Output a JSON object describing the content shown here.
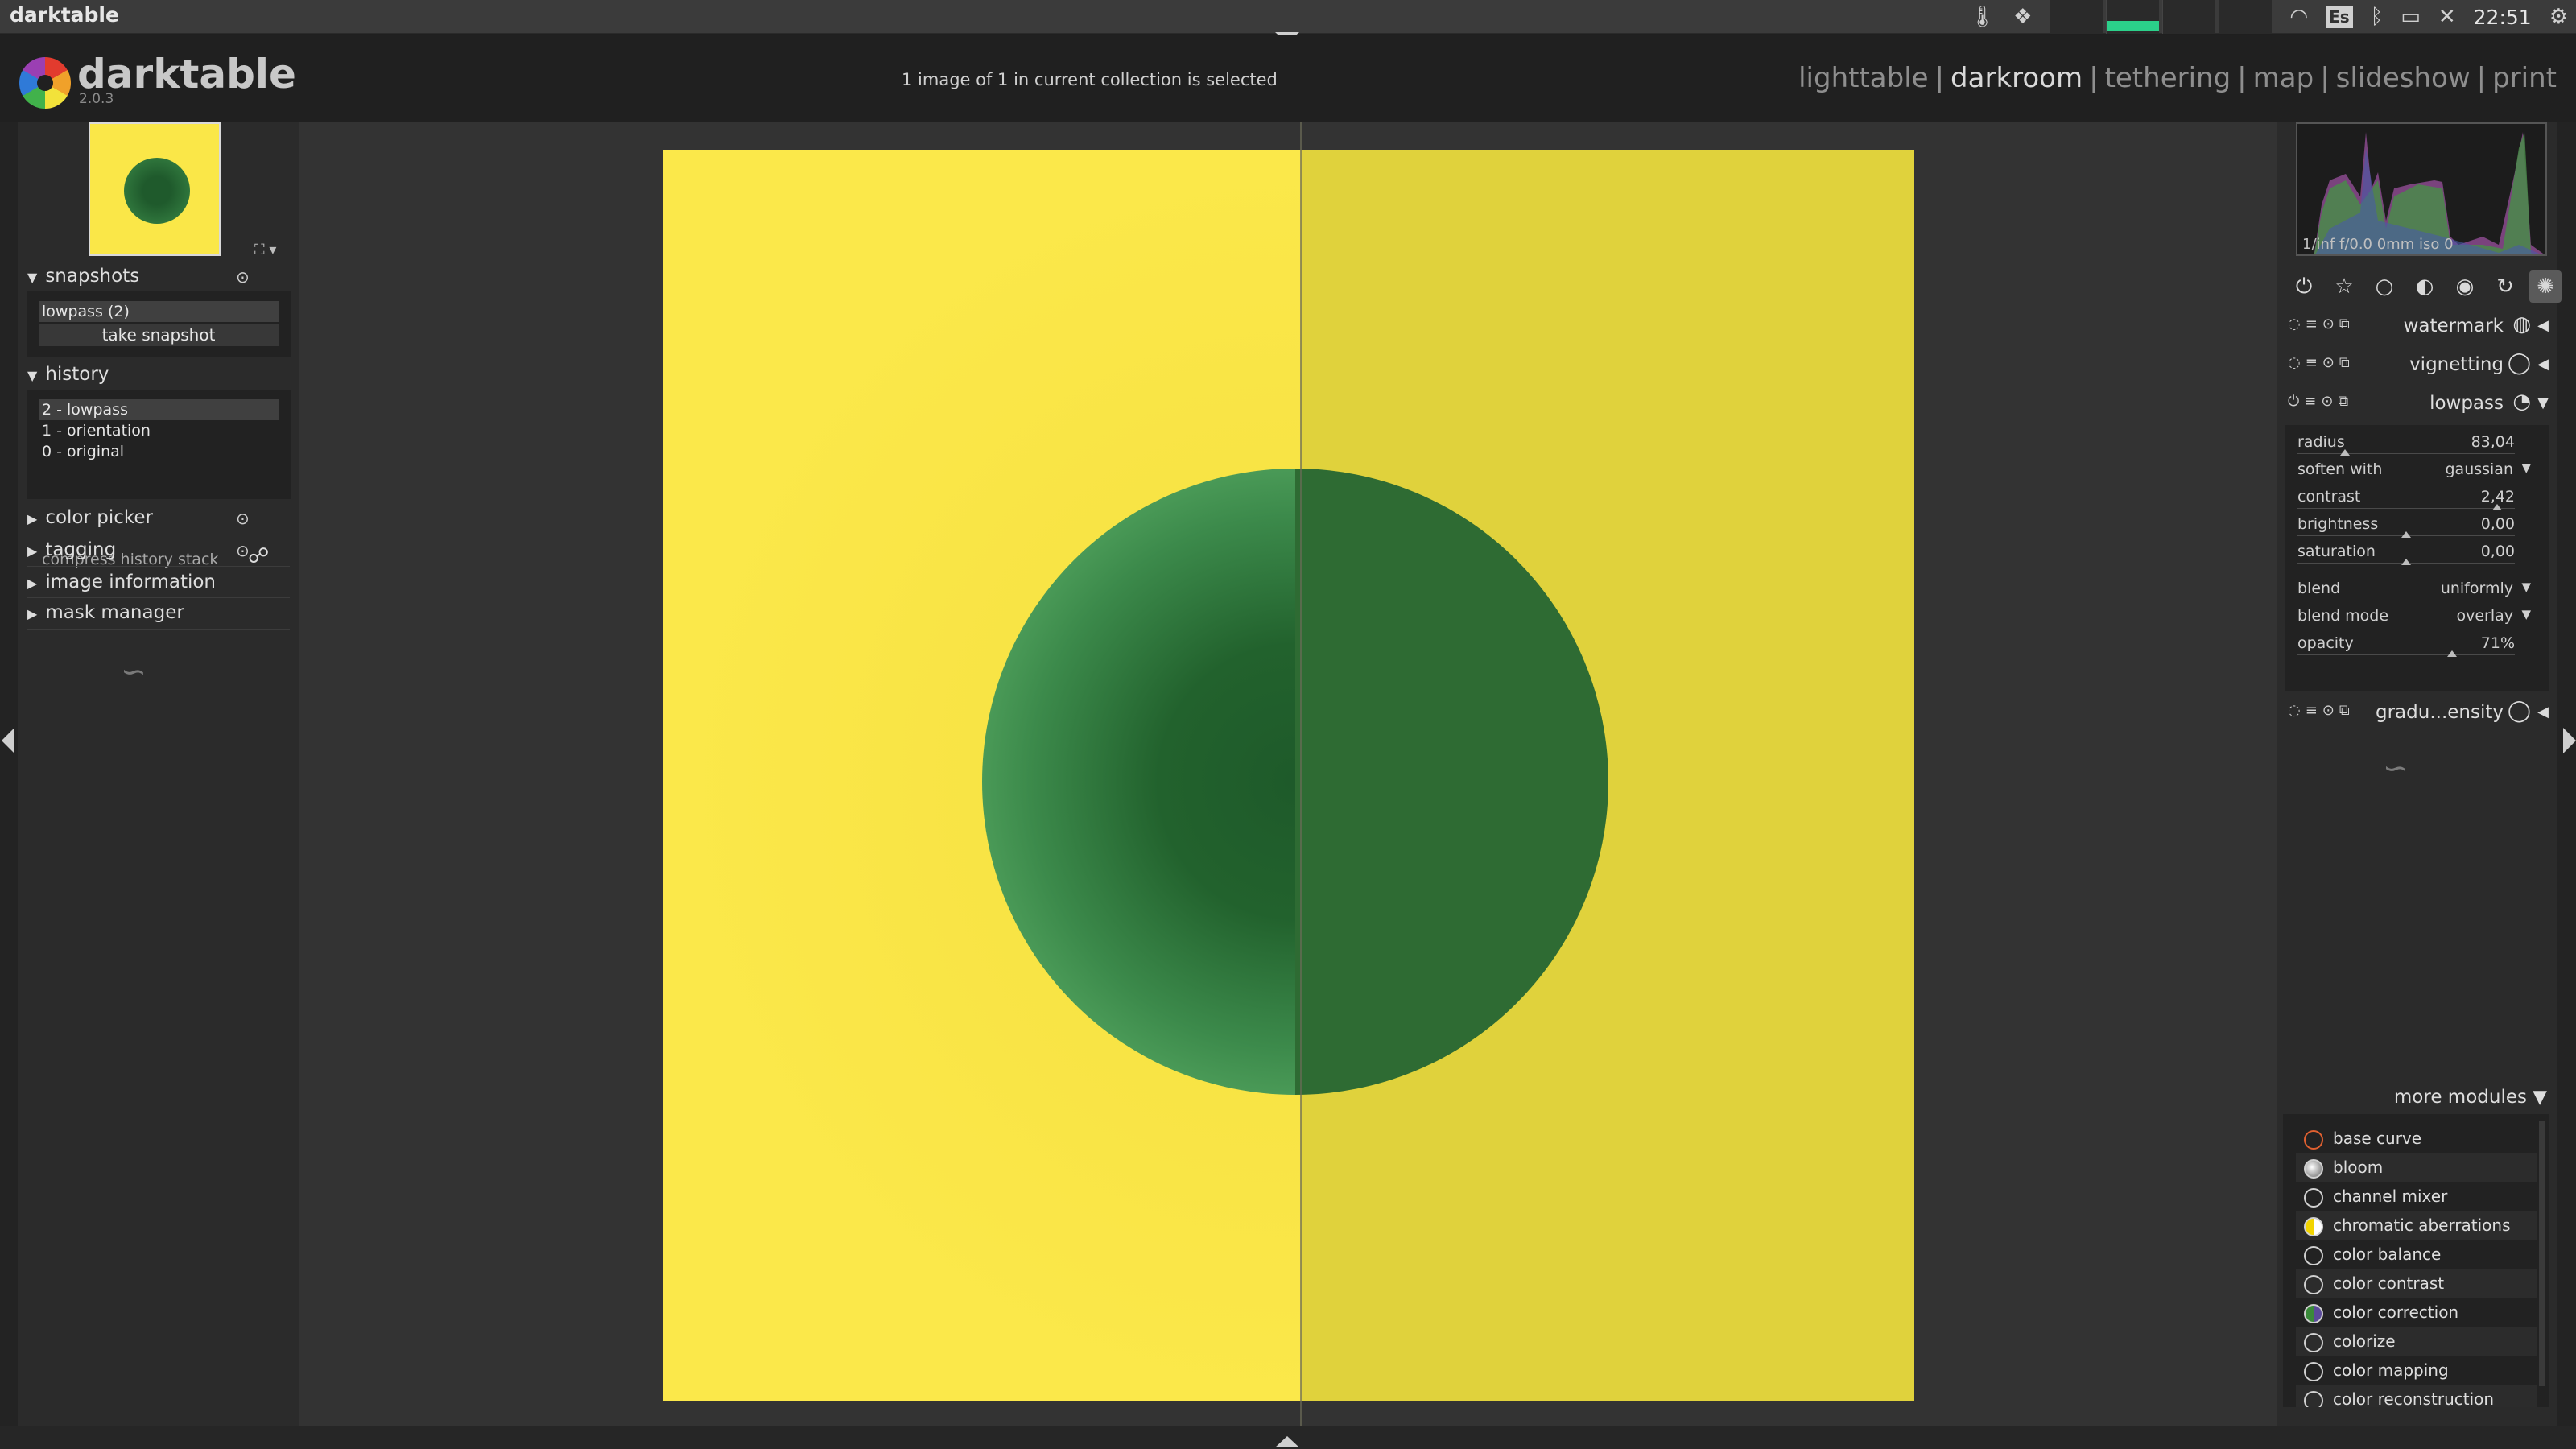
{
  "topbar": {
    "app_name": "darktable",
    "keyboard_layout": "Es",
    "clock": "22:51"
  },
  "header": {
    "logo_title": "darktable",
    "version": "2.0.3",
    "status": "1 image of 1 in current collection is selected",
    "views": [
      "lighttable",
      "darkroom",
      "tethering",
      "map",
      "slideshow",
      "print"
    ],
    "active_view": "darkroom"
  },
  "left_panel": {
    "snapshots": {
      "title": "snapshots",
      "items": [
        "lowpass (2)"
      ],
      "take_snapshot": "take snapshot"
    },
    "history": {
      "title": "history",
      "items": [
        "2 - lowpass",
        "1 - orientation",
        "0 - original"
      ],
      "selected_index": 0,
      "compress": "compress history stack"
    },
    "modules": [
      "color picker",
      "tagging",
      "image information",
      "mask manager"
    ]
  },
  "right_panel": {
    "histogram_info": "1/inf f/0.0 0mm iso 0",
    "modules": {
      "watermark": "watermark",
      "vignetting": "vignetting",
      "lowpass": "lowpass",
      "graduated": "gradu...ensity"
    },
    "lowpass": {
      "radius": {
        "label": "radius",
        "value": "83,04",
        "pos": 0.22
      },
      "soften_with": {
        "label": "soften with",
        "value": "gaussian"
      },
      "contrast": {
        "label": "contrast",
        "value": "2,42",
        "pos": 0.92
      },
      "brightness": {
        "label": "brightness",
        "value": "0,00",
        "pos": 0.5
      },
      "saturation": {
        "label": "saturation",
        "value": "0,00",
        "pos": 0.5
      },
      "blend": {
        "label": "blend",
        "value": "uniformly"
      },
      "blend_mode": {
        "label": "blend mode",
        "value": "overlay"
      },
      "opacity": {
        "label": "opacity",
        "value": "71%",
        "pos": 0.71
      }
    },
    "more_modules": {
      "label": "more modules",
      "items": [
        "base curve",
        "bloom",
        "channel mixer",
        "chromatic aberrations",
        "color balance",
        "color contrast",
        "color correction",
        "colorize",
        "color mapping",
        "color reconstruction"
      ]
    }
  },
  "colors": {
    "accent_yellow": "#fae648",
    "circle_green": "#2e6b33",
    "panel_bg": "#2b2b2b"
  }
}
